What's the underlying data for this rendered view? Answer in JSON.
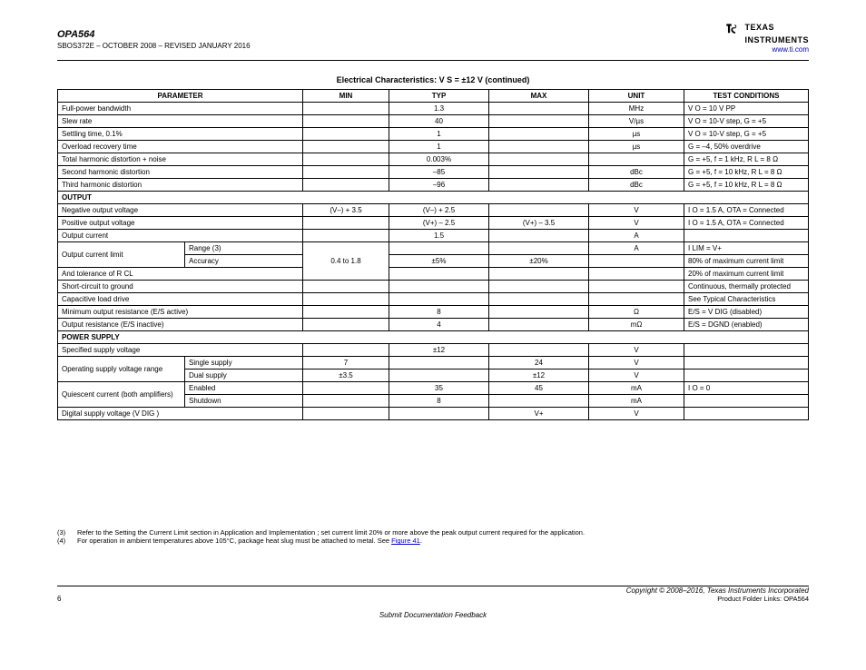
{
  "header": {
    "part": "OPA564",
    "rev": "SBOS372E – OCTOBER 2008 – REVISED JANUARY 2016",
    "brand_top": "TEXAS",
    "brand_bot": "INSTRUMENTS",
    "site": "www.ti.com"
  },
  "caption": "Electrical Characteristics: V S  = ±12 V (continued)",
  "cols": {
    "param": "PARAMETER",
    "min": "MIN",
    "typ": "TYP",
    "max": "MAX",
    "unit": "UNIT",
    "test": "TEST CONDITIONS"
  },
  "rows": [
    {
      "p": "Full-power bandwidth",
      "min": "",
      "typ": "1.3",
      "max": "",
      "unit": "MHz",
      "test": "V O  = 10 V PP"
    },
    {
      "p": "Slew rate",
      "min": "",
      "typ": "40",
      "max": "",
      "unit": "V/µs",
      "test": "V O  = 10-V step, G = +5"
    },
    {
      "p": "Settling time, 0.1%",
      "min": "",
      "typ": "1",
      "max": "",
      "unit": "µs",
      "test": "V O  = 10-V step, G = +5"
    },
    {
      "p": "Overload recovery time",
      "min": "",
      "typ": "1",
      "max": "",
      "unit": "µs",
      "test": "G = –4, 50% overdrive"
    },
    {
      "p": "Total harmonic distortion + noise",
      "min": "",
      "typ": "0.003%",
      "max": "",
      "unit": "",
      "test": "G = +5, f = 1 kHz, R L  = 8 Ω"
    },
    {
      "p": "Second harmonic distortion",
      "min": "",
      "typ": "–85",
      "max": "",
      "unit": "dBc",
      "test": "G = +5, f = 10 kHz, R L  = 8 Ω"
    },
    {
      "p": "Third harmonic distortion",
      "min": "",
      "typ": "–96",
      "max": "",
      "unit": "dBc",
      "test": "G = +5, f = 10 kHz, R L  = 8 Ω"
    }
  ],
  "sec_output": "OUTPUT",
  "out_rows": [
    {
      "p": "Negative output voltage",
      "min": "(V–) + 3.5",
      "typ": "(V–) + 2.5",
      "max": "",
      "unit": "V",
      "test": "I O  = 1.5 A, OTA = Connected"
    },
    {
      "p": "Positive output voltage",
      "min": "",
      "typ": "(V+) – 2.5",
      "max": "(V+) – 3.5",
      "unit": "V",
      "test": "I O  = 1.5 A, OTA = Connected"
    },
    {
      "p": "Output current",
      "min": "",
      "typ": "1.5",
      "max": "",
      "unit": "A",
      "test": ""
    }
  ],
  "ilim": {
    "label": "Output current limit",
    "r1": {
      "sub": "Range (3)",
      "min": "",
      "typ": "",
      "max": "",
      "unit": "A",
      "test": "I LIM  = V+"
    },
    "r2": {
      "sub": "Accuracy",
      "min": "",
      "typ": "±5%",
      "max": "±20%",
      "unit": "",
      "test": "80% of maximum current limit"
    },
    "tol": {
      "p": "And tolerance of R CL",
      "min": "",
      "typ": "",
      "max": "",
      "unit": "",
      "test": "20% of maximum current limit"
    }
  },
  "out_rows2": [
    {
      "p": "Short-circuit to ground",
      "min": "",
      "typ": "",
      "max": "",
      "unit": "",
      "test": "Continuous, thermally protected"
    },
    {
      "p": "Capacitive load drive",
      "min": "",
      "typ": "",
      "max": "",
      "unit": "",
      "test": "See Typical Characteristics"
    },
    {
      "p": "Minimum output resistance (E/S active)",
      "min": "",
      "typ": "8",
      "max": "",
      "unit": "Ω",
      "test": "E/S = V DIG  (disabled)"
    },
    {
      "p": "Output resistance (E/S inactive)",
      "min": "",
      "typ": "4",
      "max": "",
      "unit": "mΩ",
      "test": "E/S = DGND (enabled)"
    }
  ],
  "sec_power": "POWER SUPPLY",
  "ps_rows": [
    {
      "p": "Specified supply voltage",
      "min": "",
      "typ": "±12",
      "max": "",
      "unit": "V",
      "test": ""
    }
  ],
  "vrange": {
    "label": "Operating supply voltage range",
    "r1": {
      "sub": "Single supply",
      "min": "7",
      "typ": "",
      "max": "24",
      "unit": "V",
      "test": ""
    },
    "r2": {
      "sub": "Dual supply",
      "min": "±3.5",
      "typ": "",
      "max": "±12",
      "unit": "V",
      "test": ""
    }
  },
  "iq": {
    "label": "Quiescent current (both amplifiers)",
    "r1": {
      "sub": "Enabled",
      "min": "",
      "typ": "35",
      "max": "45",
      "unit": "mA",
      "test": "I O  = 0"
    },
    "r2": {
      "sub": "Shutdown",
      "min": "",
      "typ": "8",
      "max": "",
      "unit": "mA",
      "test": ""
    }
  },
  "vdig": {
    "p": "Digital supply voltage (V DIG )",
    "min": "",
    "typ": "",
    "max": "V+",
    "unit": "V",
    "test": ""
  },
  "footnotes": {
    "f3n": "(3)",
    "f3": "Refer to the Setting the Current Limit section in Application and Implementation ; set current limit 20% or more above the peak output current required for the application.",
    "f4n": "(4)",
    "f4": "For operation in ambient temperatures above 105°C, package heat slug must be attached to metal. See ",
    "f4a": "Figure 41",
    "f4b": "."
  },
  "footer": {
    "pg": "6",
    "center": "Submit Documentation Feedback",
    "r1": "Copyright © 2008–2016, Texas Instruments Incorporated",
    "r2": "Product Folder Links: OPA564"
  },
  "ilim_range_val": "0.4 to 1.8"
}
